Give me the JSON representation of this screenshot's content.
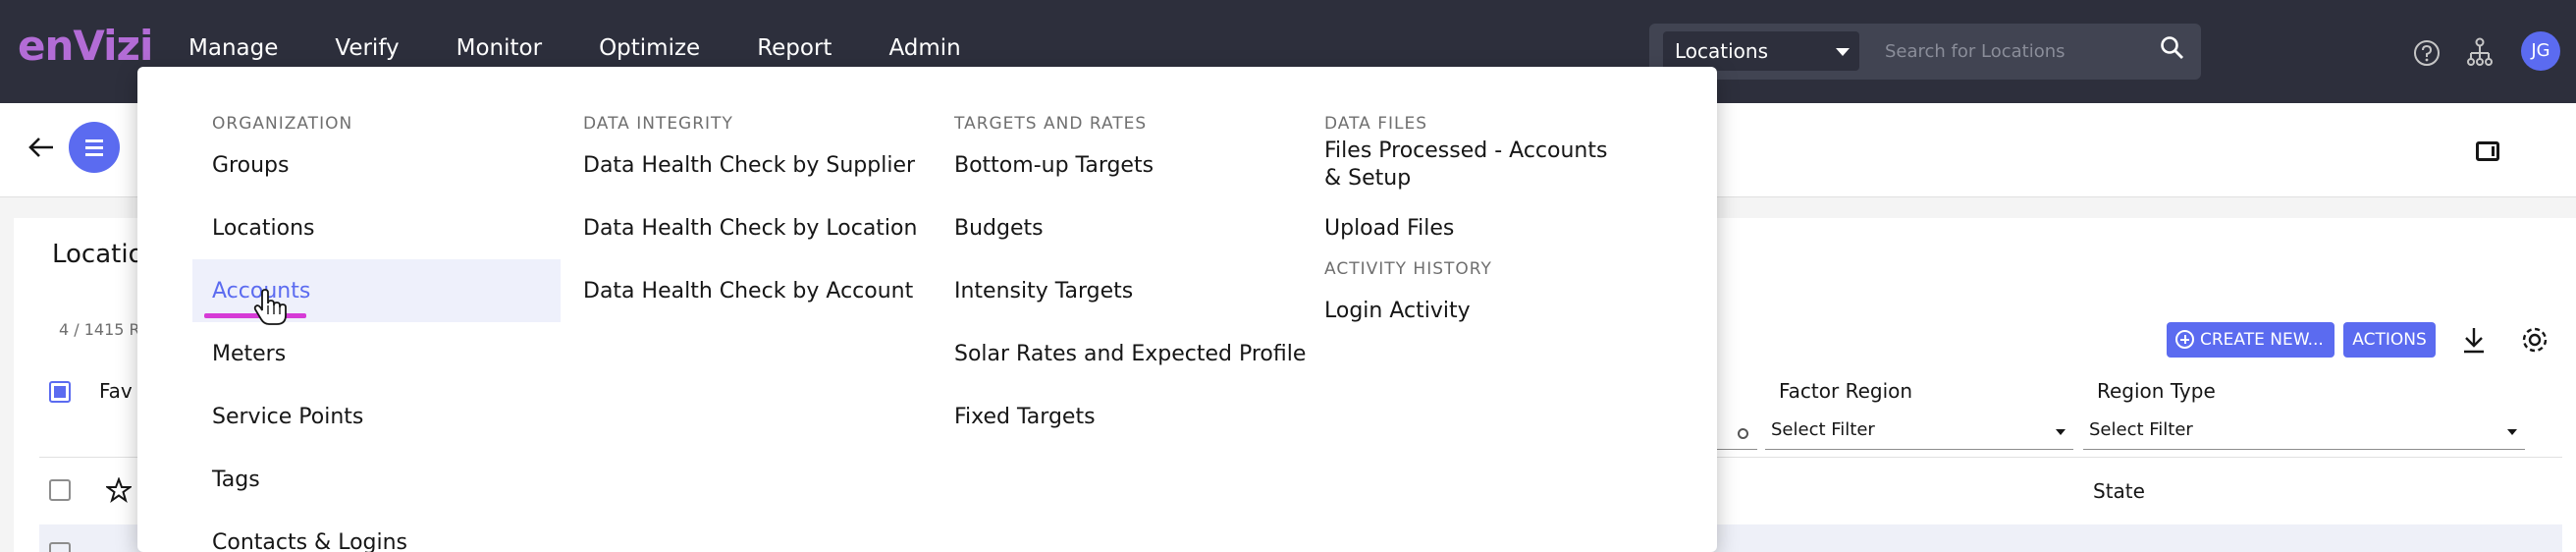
{
  "header": {
    "logo": "enVizi",
    "nav": [
      "Manage",
      "Verify",
      "Monitor",
      "Optimize",
      "Report",
      "Admin"
    ],
    "search_scope": "Locations",
    "search_placeholder": "Search for Locations",
    "avatar_initials": "JG"
  },
  "page": {
    "title": "Locatio",
    "count": "4 / 1415 R",
    "create_label": "CREATE NEW...",
    "actions_label": "ACTIONS"
  },
  "table": {
    "columns": {
      "fav": "Fav",
      "factor_region": "Factor Region",
      "region_type": "Region Type"
    },
    "filter_placeholder": "Select Filter",
    "row_state": "State"
  },
  "menu": {
    "organization": {
      "heading": "ORGANIZATION",
      "items": [
        "Groups",
        "Locations",
        "Accounts",
        "Meters",
        "Service Points",
        "Tags",
        "Contacts & Logins"
      ]
    },
    "data_integrity": {
      "heading": "DATA INTEGRITY",
      "items": [
        "Data Health Check by Supplier",
        "Data Health Check by Location",
        "Data Health Check by Account"
      ]
    },
    "targets_rates": {
      "heading": "TARGETS AND RATES",
      "items": [
        "Bottom-up Targets",
        "Budgets",
        "Intensity Targets",
        "Solar Rates and Expected Profile",
        "Fixed Targets"
      ]
    },
    "data_files": {
      "heading": "DATA FILES",
      "items": [
        "Files Processed - Accounts & Setup",
        "Upload Files"
      ]
    },
    "activity_history": {
      "heading": "ACTIVITY HISTORY",
      "items": [
        "Login Activity"
      ]
    },
    "active_item": "Accounts"
  },
  "colors": {
    "topbar": "#2d2f3c",
    "accent": "#5b6bf0",
    "logo": "#b36cd6",
    "highlight": "#eef0fb"
  }
}
